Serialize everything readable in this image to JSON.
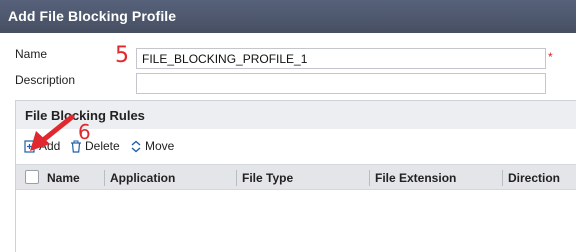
{
  "window": {
    "title": "Add File Blocking Profile"
  },
  "form": {
    "name_label": "Name",
    "name_value": "FILE_BLOCKING_PROFILE_1",
    "required_marker": "*",
    "description_label": "Description",
    "description_value": ""
  },
  "annotations": {
    "step_name": "5",
    "step_add": "6"
  },
  "rules_panel": {
    "title": "File Blocking Rules",
    "toolbar": {
      "add_label": "Add",
      "delete_label": "Delete",
      "move_label": "Move"
    },
    "columns": [
      "Name",
      "Application",
      "File Type",
      "File Extension",
      "Direction"
    ],
    "rows": []
  },
  "colors": {
    "titlebar": "#4a5368",
    "annotation": "#e0282e",
    "accent_icon": "#1f5fa8"
  }
}
